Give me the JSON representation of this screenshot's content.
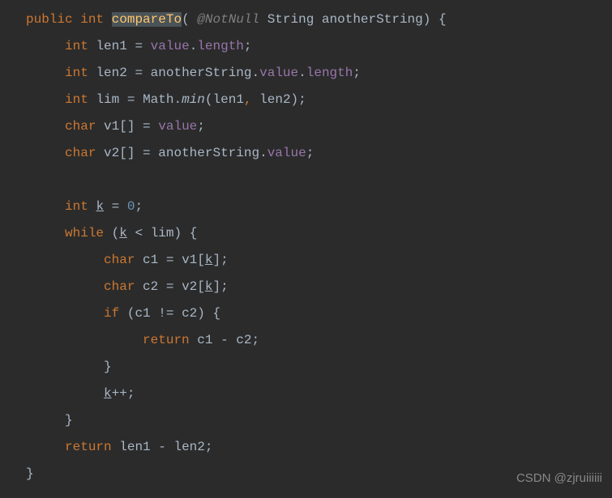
{
  "code": {
    "line1": {
      "public": "public",
      "int": "int",
      "method": "compareTo",
      "paren_open": "(",
      "annotation": "@NotNull",
      "param_type": "String",
      "param_name": "anotherString",
      "paren_close": ")",
      "brace": "{"
    },
    "line2": {
      "int": "int",
      "var": "len1",
      "eq": "=",
      "value": "value",
      "dot": ".",
      "length": "length",
      "semi": ";"
    },
    "line3": {
      "int": "int",
      "var": "len2",
      "eq": "=",
      "another": "anotherString",
      "dot1": ".",
      "value": "value",
      "dot2": ".",
      "length": "length",
      "semi": ";"
    },
    "line4": {
      "int": "int",
      "var": "lim",
      "eq": "=",
      "math": "Math",
      "dot": ".",
      "min": "min",
      "paren_open": "(",
      "arg1": "len1",
      "comma": ",",
      "arg2": "len2",
      "paren_close": ")",
      "semi": ";"
    },
    "line5": {
      "char": "char",
      "var": "v1",
      "brackets": "[]",
      "eq": "=",
      "value": "value",
      "semi": ";"
    },
    "line6": {
      "char": "char",
      "var": "v2",
      "brackets": "[]",
      "eq": "=",
      "another": "anotherString",
      "dot": ".",
      "value": "value",
      "semi": ";"
    },
    "line8": {
      "int": "int",
      "var": "k",
      "eq": "=",
      "zero": "0",
      "semi": ";"
    },
    "line9": {
      "while": "while",
      "paren_open": "(",
      "k": "k",
      "lt": "<",
      "lim": "lim",
      "paren_close": ")",
      "brace": "{"
    },
    "line10": {
      "char": "char",
      "var": "c1",
      "eq": "=",
      "v1": "v1",
      "bracket_open": "[",
      "k": "k",
      "bracket_close": "]",
      "semi": ";"
    },
    "line11": {
      "char": "char",
      "var": "c2",
      "eq": "=",
      "v2": "v2",
      "bracket_open": "[",
      "k": "k",
      "bracket_close": "]",
      "semi": ";"
    },
    "line12": {
      "if": "if",
      "paren_open": "(",
      "c1": "c1",
      "neq": "!=",
      "c2": "c2",
      "paren_close": ")",
      "brace": "{"
    },
    "line13": {
      "return": "return",
      "c1": "c1",
      "minus": "-",
      "c2": "c2",
      "semi": ";"
    },
    "line14": {
      "brace": "}"
    },
    "line15": {
      "k": "k",
      "inc": "++",
      "semi": ";"
    },
    "line16": {
      "brace": "}"
    },
    "line17": {
      "return": "return",
      "len1": "len1",
      "minus": "-",
      "len2": "len2",
      "semi": ";"
    },
    "line18": {
      "brace": "}"
    }
  },
  "watermark": "CSDN @zjruiiiiii"
}
